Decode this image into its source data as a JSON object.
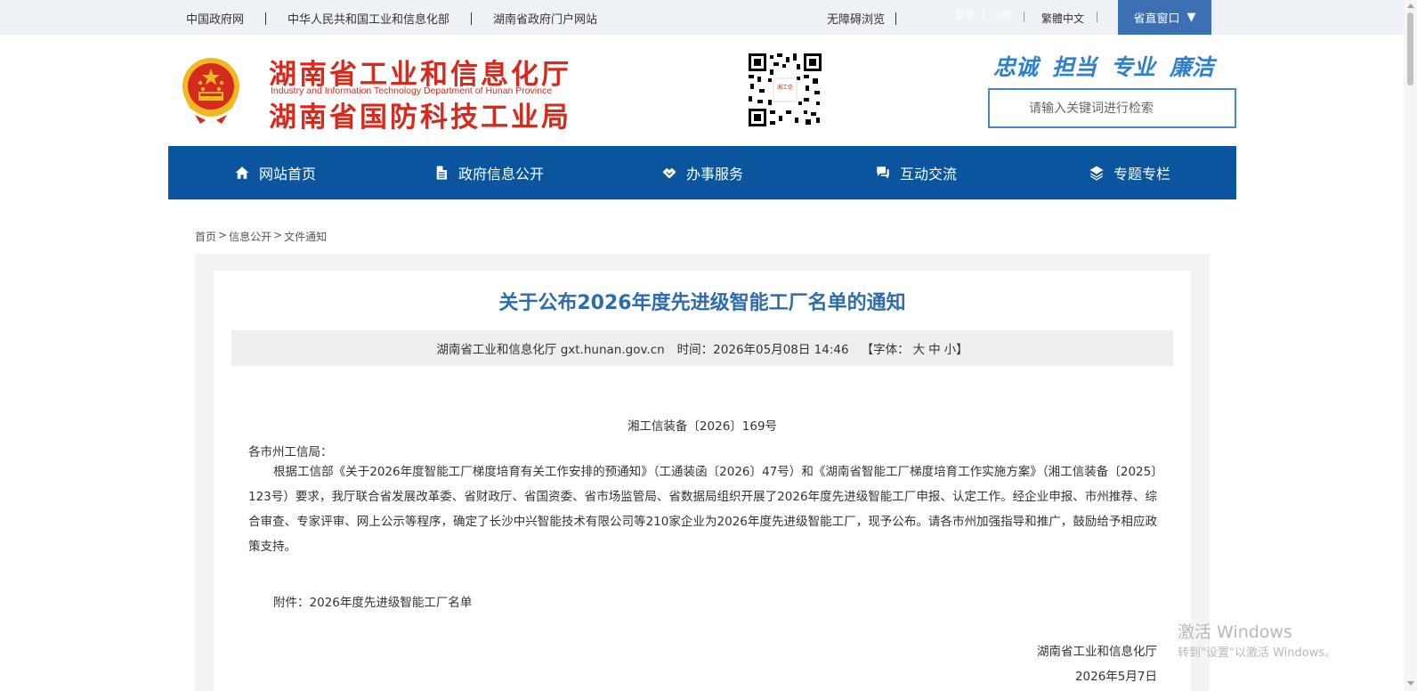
{
  "topbar": {
    "links": [
      "中国政府网",
      "中华人民共和国工业和信息化部",
      "湖南省政府门户网站"
    ],
    "accessibility": "无障碍浏览",
    "login": "登录",
    "register": "注册",
    "traditional": "繁體中文",
    "window_button": "省直窗口",
    "window_arrow": "▼"
  },
  "header": {
    "title_line1": "湖南省工业和信息化厅",
    "title_en": "Industry and Information Technology Department of Hunan Province",
    "title_line2": "湖南省国防科技工业局",
    "qrcode_label": "湘工信",
    "slogan": [
      "忠诚",
      "担当",
      "专业",
      "廉洁"
    ],
    "search_placeholder": "请输入关键词进行检索"
  },
  "nav": [
    {
      "label": "网站首页",
      "icon": "home-icon"
    },
    {
      "label": "政府信息公开",
      "icon": "document-icon"
    },
    {
      "label": "办事服务",
      "icon": "handshake-icon"
    },
    {
      "label": "互动交流",
      "icon": "chat-icon"
    },
    {
      "label": "专题专栏",
      "icon": "layers-icon"
    }
  ],
  "breadcrumb": [
    "首页",
    "信息公开",
    "文件通知"
  ],
  "breadcrumb_sep": ">",
  "article": {
    "title": "关于公布2026年度先进级智能工厂名单的通知",
    "source": "湖南省工业和信息化厅 gxt.hunan.gov.cn",
    "time": "时间：2026年05月08日 14:46",
    "font_label": "【字体：",
    "font_large": "大",
    "font_medium": "中",
    "font_small": "小】",
    "doc_no": "湘工信装备〔2026〕169号",
    "greeting": "各市州工信局：",
    "body": "根据工信部《关于2026年度智能工厂梯度培育有关工作安排的预通知》（工通装函〔2026〕47号）和《湖南省智能工厂梯度培育工作实施方案》（湘工信装备〔2025〕123号）要求，我厅联合省发展改革委、省财政厅、省国资委、省市场监管局、省数据局组织开展了2026年度先进级智能工厂申报、认定工作。经企业申报、市州推荐、综合审查、专家评审、网上公示等程序，确定了长沙中兴智能技术有限公司等210家企业为2026年度先进级智能工厂，现予公布。请各市州加强指导和推广，鼓励给予相应政策支持。",
    "attachment": "附件：2026年度先进级智能工厂名单",
    "sign_org": "湖南省工业和信息化厅",
    "sign_date": "2026年5月7日"
  },
  "watermark": {
    "line1": "激活 Windows",
    "line2": "转到\"设置\"以激活 Windows。"
  },
  "colors": {
    "nav_bg": "#0a559e",
    "title_red": "#d52b1e",
    "article_title": "#2f6cae",
    "window_btn": "#3d6fb3"
  }
}
